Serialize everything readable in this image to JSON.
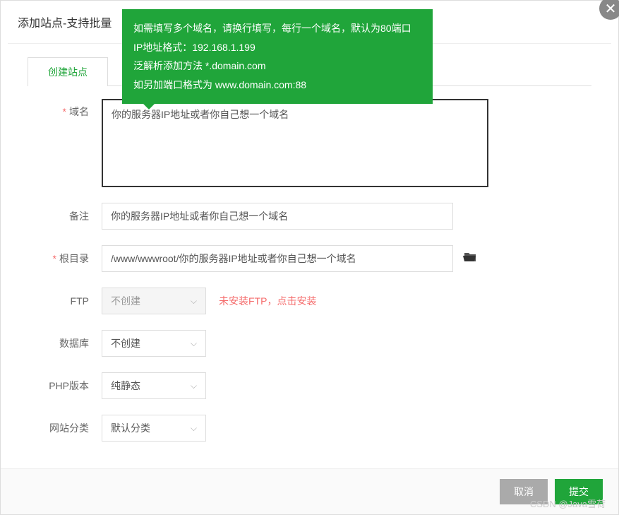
{
  "modal": {
    "title": "添加站点-支持批量"
  },
  "tooltip": {
    "line1": "如需填写多个域名，请换行填写，每行一个域名，默认为80端口",
    "line2": "IP地址格式：192.168.1.199",
    "line3": "泛解析添加方法 *.domain.com",
    "line4": "如另加端口格式为 www.domain.com:88"
  },
  "tabs": {
    "create": "创建站点"
  },
  "labels": {
    "domain": "域名",
    "remark": "备注",
    "root": "根目录",
    "ftp": "FTP",
    "database": "数据库",
    "php": "PHP版本",
    "category": "网站分类"
  },
  "fields": {
    "domain_value": "你的服务器IP地址或者你自己想一个域名",
    "remark_value": "你的服务器IP地址或者你自己想一个域名",
    "root_value": "/www/wwwroot/你的服务器IP地址或者你自己想一个域名",
    "ftp_value": "不创建",
    "ftp_warning": "未安装FTP，点击安装",
    "database_value": "不创建",
    "php_value": "纯静态",
    "category_value": "默认分类"
  },
  "buttons": {
    "cancel": "取消",
    "submit": "提交"
  },
  "watermark": "CSDN @Java雪荷"
}
